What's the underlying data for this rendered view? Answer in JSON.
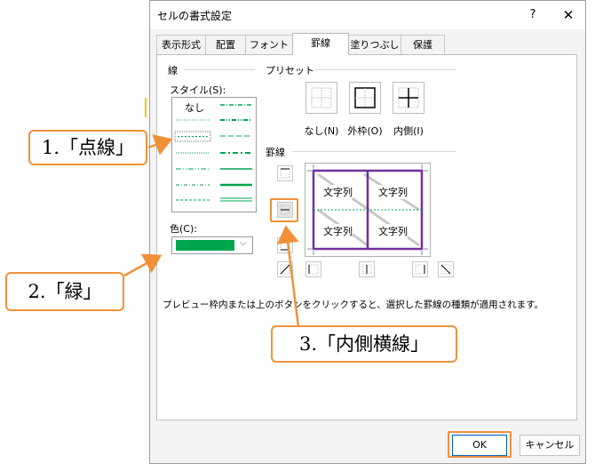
{
  "dialog": {
    "title": "セルの書式設定",
    "help": "?",
    "close": "✕",
    "tabs": [
      "表示形式",
      "配置",
      "フォント",
      "罫線",
      "塗りつぶし",
      "保護"
    ],
    "active_tab": "罫線"
  },
  "line_group": {
    "label": "線",
    "style_label": "スタイル(S):",
    "none_option": "なし",
    "color_label": "色(C):",
    "color_value": "#00a550"
  },
  "presets": {
    "label": "プリセット",
    "none": "なし(N)",
    "outline": "外枠(O)",
    "inside": "内側(I)"
  },
  "border": {
    "label": "罫線",
    "cell_text": "文字列"
  },
  "description": "プレビュー枠内または上のボタンをクリックすると、選択した罫線の種類が適用されます。",
  "buttons": {
    "ok": "OK",
    "cancel": "キャンセル"
  },
  "callouts": {
    "c1": "1.「点線」",
    "c2": "2.「緑」",
    "c3": "3.「内側横線」"
  },
  "colors": {
    "accent": "#f0913a",
    "border_color": "#7030a0",
    "line_green": "#00a550"
  }
}
